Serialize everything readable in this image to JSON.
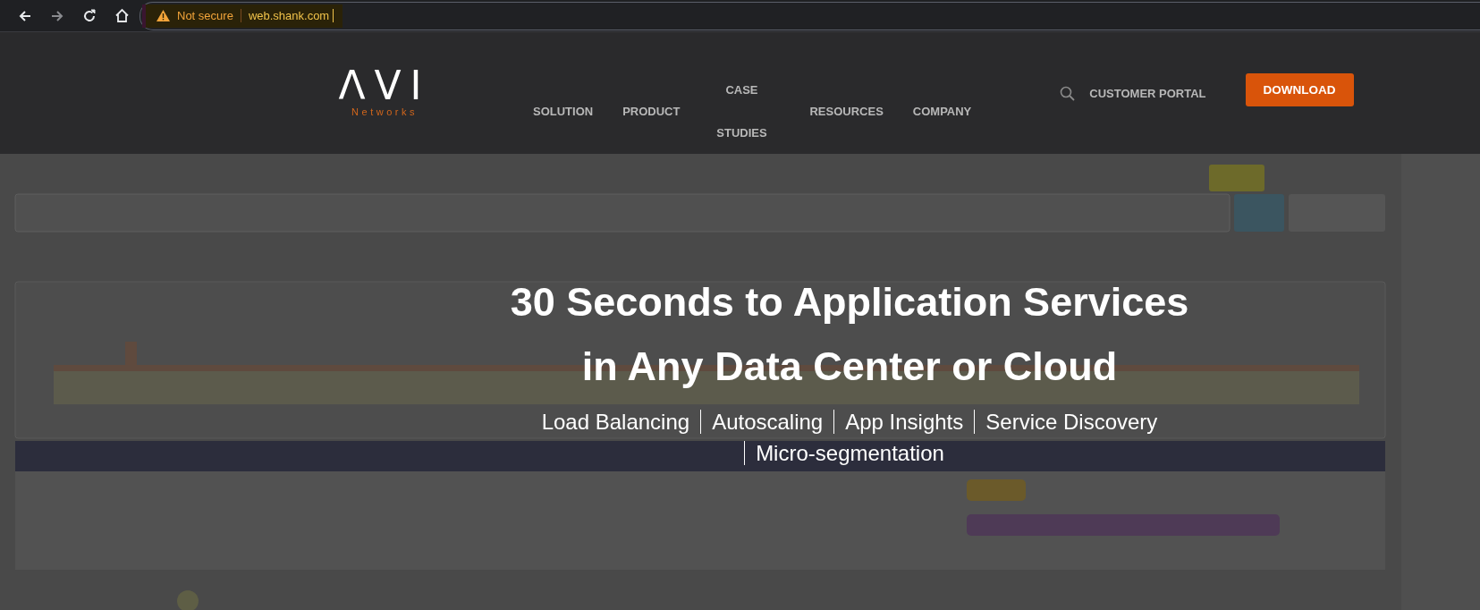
{
  "browser": {
    "back": {
      "disabled": false
    },
    "forward": {
      "disabled": true
    },
    "security_label": "Not secure",
    "url": "web.shank.com"
  },
  "header": {
    "logo": {
      "wordmark": "ΛVI",
      "tagline": "Networks"
    },
    "nav": [
      {
        "label": "SOLUTION"
      },
      {
        "label": "PRODUCT"
      },
      {
        "label": "CASE STUDIES"
      },
      {
        "label": "RESOURCES"
      },
      {
        "label": "COMPANY"
      }
    ],
    "portal_link": "CUSTOMER PORTAL",
    "download_button": "DOWNLOAD"
  },
  "hero": {
    "title_lines": [
      "30 Seconds to Application Services",
      "in Any Data Center or Cloud"
    ],
    "features": [
      "Load Balancing",
      "Autoscaling",
      "App Insights",
      "Service Discovery",
      "Micro-segmentation"
    ]
  }
}
